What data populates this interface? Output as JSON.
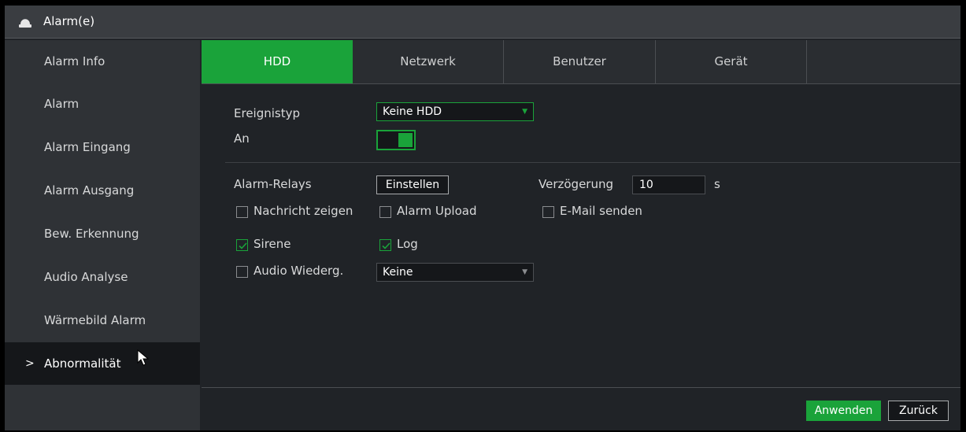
{
  "window": {
    "title": "Alarm(e)",
    "icon": "alarm-bell-icon"
  },
  "sidebar": {
    "items": [
      {
        "label": "Alarm Info"
      },
      {
        "label": "Alarm"
      },
      {
        "label": "Alarm Eingang"
      },
      {
        "label": "Alarm Ausgang"
      },
      {
        "label": "Bew. Erkennung"
      },
      {
        "label": "Audio Analyse"
      },
      {
        "label": "Wärmebild Alarm"
      },
      {
        "label": "Abnormalität",
        "chevron": ">",
        "active": true
      }
    ]
  },
  "tabs": [
    {
      "label": "HDD",
      "active": true
    },
    {
      "label": "Netzwerk"
    },
    {
      "label": "Benutzer"
    },
    {
      "label": "Gerät"
    }
  ],
  "form": {
    "event_type_label": "Ereignistyp",
    "event_type_value": "Keine HDD",
    "enable_label": "An",
    "enable_on": true,
    "alarm_relays_label": "Alarm-Relays",
    "alarm_relays_button": "Einstellen",
    "delay_label": "Verzögerung",
    "delay_value": "10",
    "delay_unit": "s",
    "show_message": {
      "label": "Nachricht zeigen",
      "checked": false
    },
    "alarm_upload": {
      "label": "Alarm Upload",
      "checked": false
    },
    "send_email": {
      "label": "E-Mail senden",
      "checked": false
    },
    "siren": {
      "label": "Sirene",
      "checked": true
    },
    "log": {
      "label": "Log",
      "checked": true
    },
    "audio_play": {
      "label": "Audio Wiederg.",
      "checked": false
    },
    "audio_value": "Keine"
  },
  "footer": {
    "apply_label": "Anwenden",
    "back_label": "Zurück"
  },
  "colors": {
    "accent": "#1aa33a",
    "background": "#202327",
    "sidebar": "#2f3236"
  }
}
